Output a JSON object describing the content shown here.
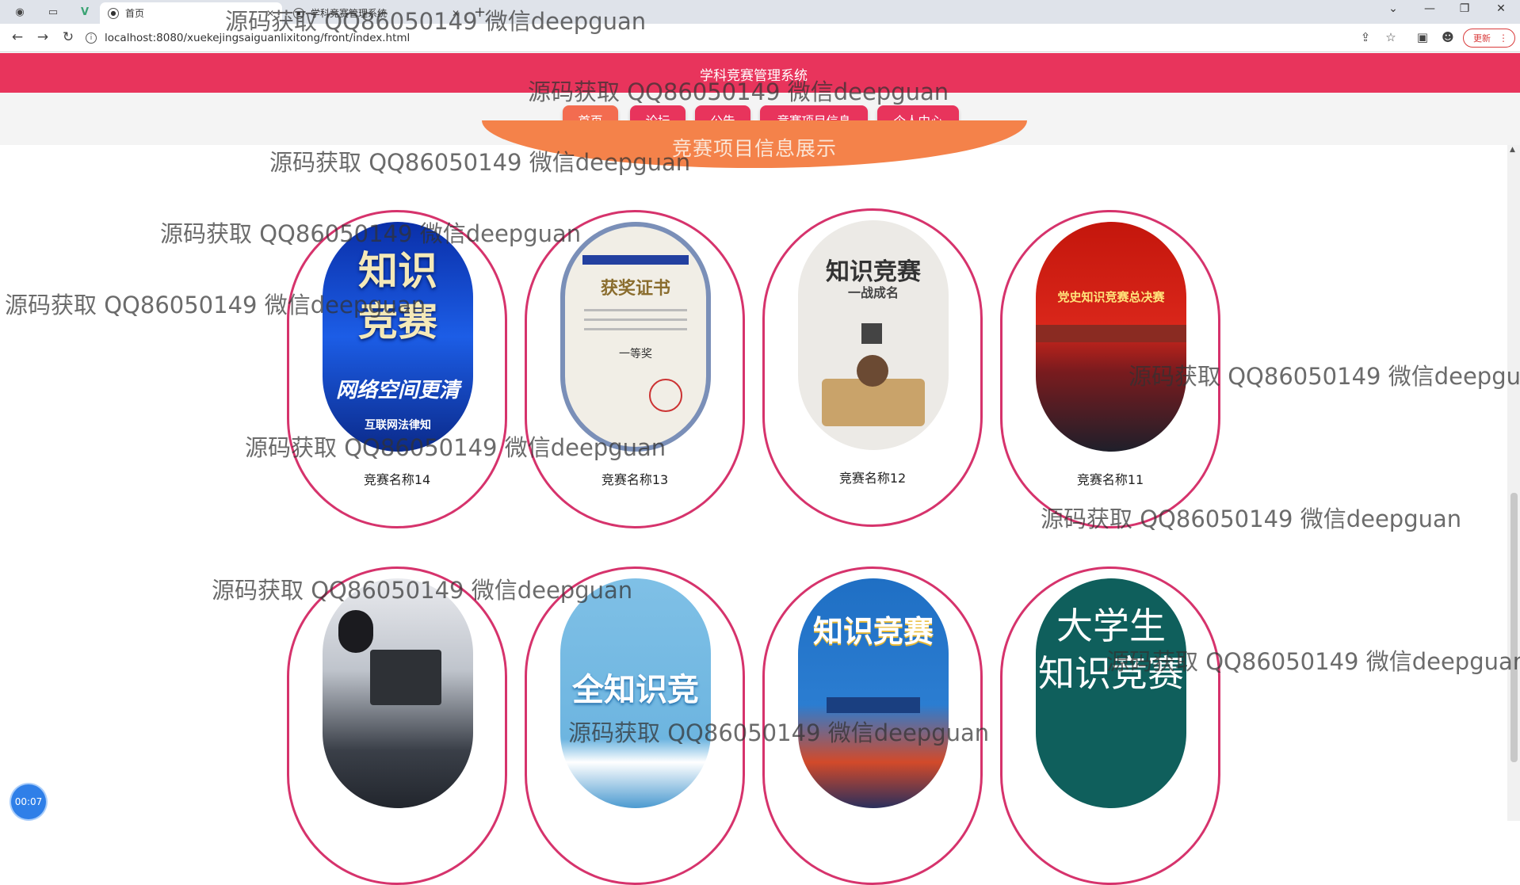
{
  "browser": {
    "active_tab_title": "首页",
    "inactive_tab_title": "学科竞赛管理系统",
    "url": "localhost:8080/xuekejingsaiguanlixitong/front/index.html",
    "update_label": "更新",
    "new_tab": "+"
  },
  "site": {
    "title": "学科竞赛管理系统",
    "nav": [
      "首页",
      "论坛",
      "公告",
      "竞赛项目信息",
      "个人中心"
    ]
  },
  "section_title": "竞赛项目信息展示",
  "cards": [
    {
      "name": "竞赛名称14",
      "image_text": [
        "知识",
        "竞赛",
        "网络空间更清",
        "互联网法律知"
      ]
    },
    {
      "name": "竞赛名称13",
      "image_text": [
        "获奖证书",
        "一等奖"
      ]
    },
    {
      "name": "竞赛名称12",
      "image_text": [
        "知识竞赛",
        "一战成名"
      ]
    },
    {
      "name": "竞赛名称11",
      "image_text": [
        "党史知识竞赛总决赛"
      ]
    },
    {
      "name": "",
      "image_text": []
    },
    {
      "name": "",
      "image_text": [
        "全知识竞"
      ]
    },
    {
      "name": "",
      "image_text": [
        "知识竞赛"
      ]
    },
    {
      "name": "",
      "image_text": [
        "大学生",
        "知识竞赛"
      ]
    }
  ],
  "watermark_text": "源码获取 QQ86050149 微信deepguan",
  "timer": "00:07",
  "colors": {
    "primary": "#e8345c",
    "active_nav": "#f36c50",
    "card_border": "#d6336c",
    "banner": "#f4824a"
  }
}
